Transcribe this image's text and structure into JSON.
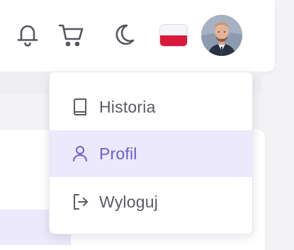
{
  "header": {
    "icons": [
      "bell-icon",
      "cart-icon",
      "moon-icon"
    ],
    "language_flag": "pl",
    "flag_colors": {
      "top": "#f5f5f7",
      "bottom": "#d9183b"
    }
  },
  "user_menu": {
    "items": [
      {
        "label": "Historia",
        "icon": "book-icon",
        "active": false
      },
      {
        "label": "Profil",
        "icon": "user-icon",
        "active": true
      },
      {
        "label": "Wyloguj",
        "icon": "logout-icon",
        "active": false
      }
    ]
  },
  "colors": {
    "accent": "#6c5dd3",
    "active_bg": "#ebe9fb",
    "icon": "#5a5a66"
  }
}
